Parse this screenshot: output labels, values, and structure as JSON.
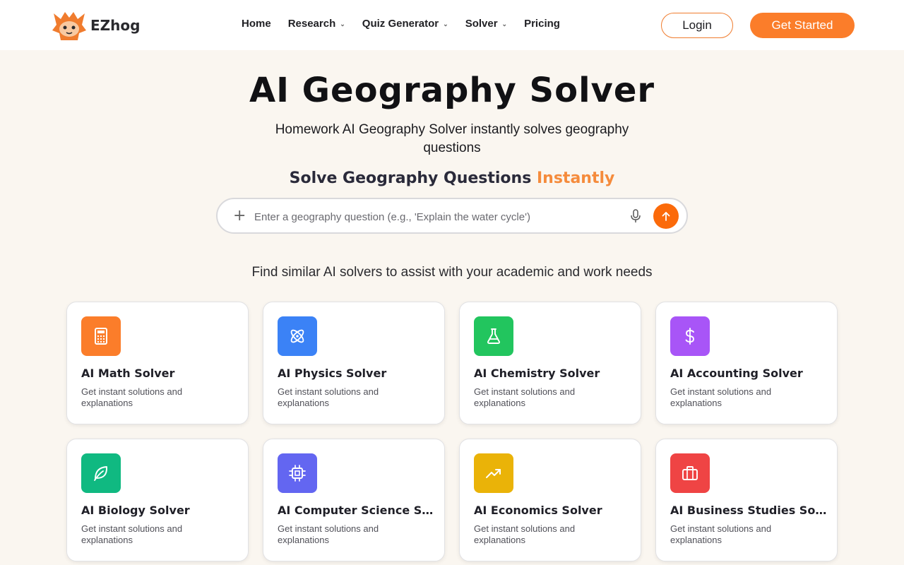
{
  "brand": {
    "name": "EZhog"
  },
  "nav": {
    "items": [
      {
        "label": "Home",
        "dropdown": false
      },
      {
        "label": "Research",
        "dropdown": true
      },
      {
        "label": "Quiz Generator",
        "dropdown": true
      },
      {
        "label": "Solver",
        "dropdown": true
      },
      {
        "label": "Pricing",
        "dropdown": false
      }
    ],
    "login_label": "Login",
    "get_started_label": "Get Started"
  },
  "hero": {
    "title": "AI Geography Solver",
    "subtitle": "Homework AI Geography Solver instantly solves geography questions",
    "tagline_main": "Solve Geography Questions",
    "tagline_accent": "Instantly"
  },
  "search": {
    "value": "",
    "placeholder": "Enter a geography question (e.g., 'Explain the water cycle')"
  },
  "similar_heading": "Find similar AI solvers to assist with your academic and work needs",
  "solvers": [
    {
      "title": "AI Math Solver",
      "description": "Get instant solutions and explanations",
      "icon": "calculator-icon",
      "color": "#fb7d2a"
    },
    {
      "title": "AI Physics Solver",
      "description": "Get instant solutions and explanations",
      "icon": "atom-icon",
      "color": "#3b82f6"
    },
    {
      "title": "AI Chemistry Solver",
      "description": "Get instant solutions and explanations",
      "icon": "flask-icon",
      "color": "#22c55e"
    },
    {
      "title": "AI Accounting Solver",
      "description": "Get instant solutions and explanations",
      "icon": "dollar-icon",
      "color": "#a855f7"
    },
    {
      "title": "AI Biology Solver",
      "description": "Get instant solutions and explanations",
      "icon": "leaf-icon",
      "color": "#10b981"
    },
    {
      "title": "AI Computer Science Sol...",
      "description": "Get instant solutions and explanations",
      "icon": "chip-icon",
      "color": "#6366f1"
    },
    {
      "title": "AI Economics Solver",
      "description": "Get instant solutions and explanations",
      "icon": "trending-up-icon",
      "color": "#eab308"
    },
    {
      "title": "AI Business Studies Solver",
      "description": "Get instant solutions and explanations",
      "icon": "briefcase-icon",
      "color": "#ef4444"
    }
  ],
  "colors": {
    "accent": "#fb7d2a",
    "page_bg": "#faf6f0"
  }
}
